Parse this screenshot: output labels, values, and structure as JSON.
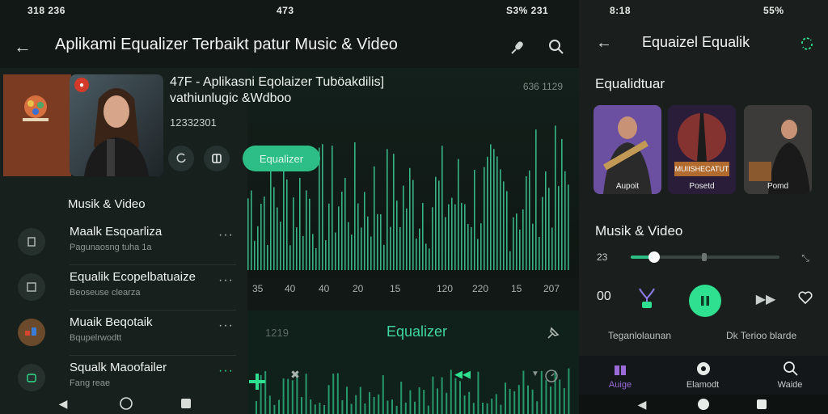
{
  "left_screen": {
    "status_left": "318 236",
    "status_center": "473",
    "status_right": "S3% 231",
    "title": "Aplikami Equalizer Terbaikt patur Music & Video",
    "viz_counter": "636 1129",
    "track_title": "47F - Aplikasni Eqolaizer Tuböakdilis]",
    "track_title_line2": "vathiunlugic &Wdboo",
    "track_number": "12332301",
    "equalizer_button": "Equalizer",
    "section": "Musik & Video",
    "list": [
      {
        "title": "Maalk Esqoarliza",
        "subtitle": "Pagunaosng tuha 1a"
      },
      {
        "title": "Equalik Ecopelbatuaize",
        "subtitle": "Beoseuse clearza"
      },
      {
        "title": "Muaik Beqotaik",
        "subtitle": "Bqupelrwodtt"
      },
      {
        "title": "Squalk Maoofailer",
        "subtitle": "Fang reae"
      }
    ],
    "axis_labels": [
      "35",
      "40",
      "40",
      "20",
      "15",
      "120",
      "220",
      "15",
      "207"
    ],
    "lower_left_label": "1219",
    "lower_title": "Equalizer",
    "more_glyph": "···"
  },
  "right_screen": {
    "status_time": "8:18",
    "status_right": "55%",
    "title": "Equaizel Equalik",
    "section": "Equalidtuar",
    "cards": [
      {
        "label": "Aupoit"
      },
      {
        "label": "Posetd",
        "caption": "MUIISHECATUT"
      },
      {
        "label": "Pomd"
      }
    ],
    "musik": "Musik & Video",
    "time": "23",
    "progress": 0.16,
    "elapsed": "00",
    "captions": [
      "Teganlolaunan",
      "Dk Terioo blarde"
    ],
    "nav": [
      {
        "label": "Auige"
      },
      {
        "label": "Elamodt"
      },
      {
        "label": "Waide"
      }
    ]
  },
  "colors": {
    "accent": "#2dbd86",
    "bg": "#121816",
    "panel": "#17201d"
  }
}
